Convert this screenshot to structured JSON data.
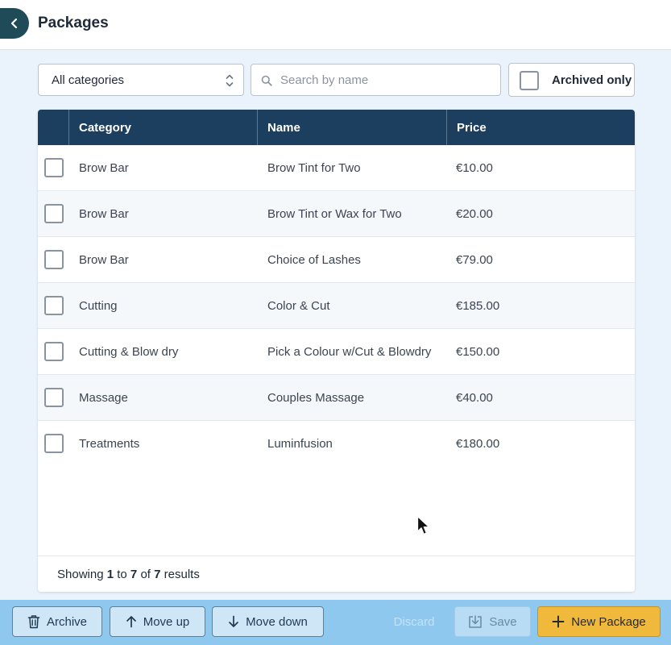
{
  "header": {
    "title": "Packages"
  },
  "toolbar": {
    "category_select": "All categories",
    "search_placeholder": "Search by name",
    "search_value": "",
    "archived_label": "Archived only",
    "archived_checked": false
  },
  "table": {
    "columns": [
      "Category",
      "Name",
      "Price"
    ],
    "rows": [
      {
        "category": "Brow Bar",
        "name": "Brow Tint for Two",
        "price": "€10.00"
      },
      {
        "category": "Brow Bar",
        "name": "Brow Tint or Wax for Two",
        "price": "€20.00"
      },
      {
        "category": "Brow Bar",
        "name": "Choice of Lashes",
        "price": "€79.00"
      },
      {
        "category": "Cutting",
        "name": "Color & Cut",
        "price": "€185.00"
      },
      {
        "category": "Cutting & Blow dry",
        "name": "Pick a Colour w/Cut & Blowdry",
        "price": "€150.00"
      },
      {
        "category": "Massage",
        "name": "Couples Massage",
        "price": "€40.00"
      },
      {
        "category": "Treatments",
        "name": "Luminfusion",
        "price": "€180.00"
      }
    ],
    "footer": {
      "prefix": "Showing",
      "from": "1",
      "to_word": "to",
      "to": "7",
      "of_word": "of",
      "total": "7",
      "suffix": "results"
    }
  },
  "actions": {
    "archive": "Archive",
    "move_up": "Move up",
    "move_down": "Move down",
    "discard": "Discard",
    "save": "Save",
    "new_package": "New Package"
  },
  "colors": {
    "header_dark": "#1c3f60",
    "back_button": "#1f4a57",
    "bottom_bar": "#8ec8ef",
    "primary_accent": "#f1b93c"
  },
  "icons": [
    "chevron-left-icon",
    "select-arrows-icon",
    "search-icon",
    "trash-icon",
    "arrow-up-icon",
    "arrow-down-icon",
    "save-icon",
    "plus-icon",
    "mouse-cursor-icon"
  ]
}
